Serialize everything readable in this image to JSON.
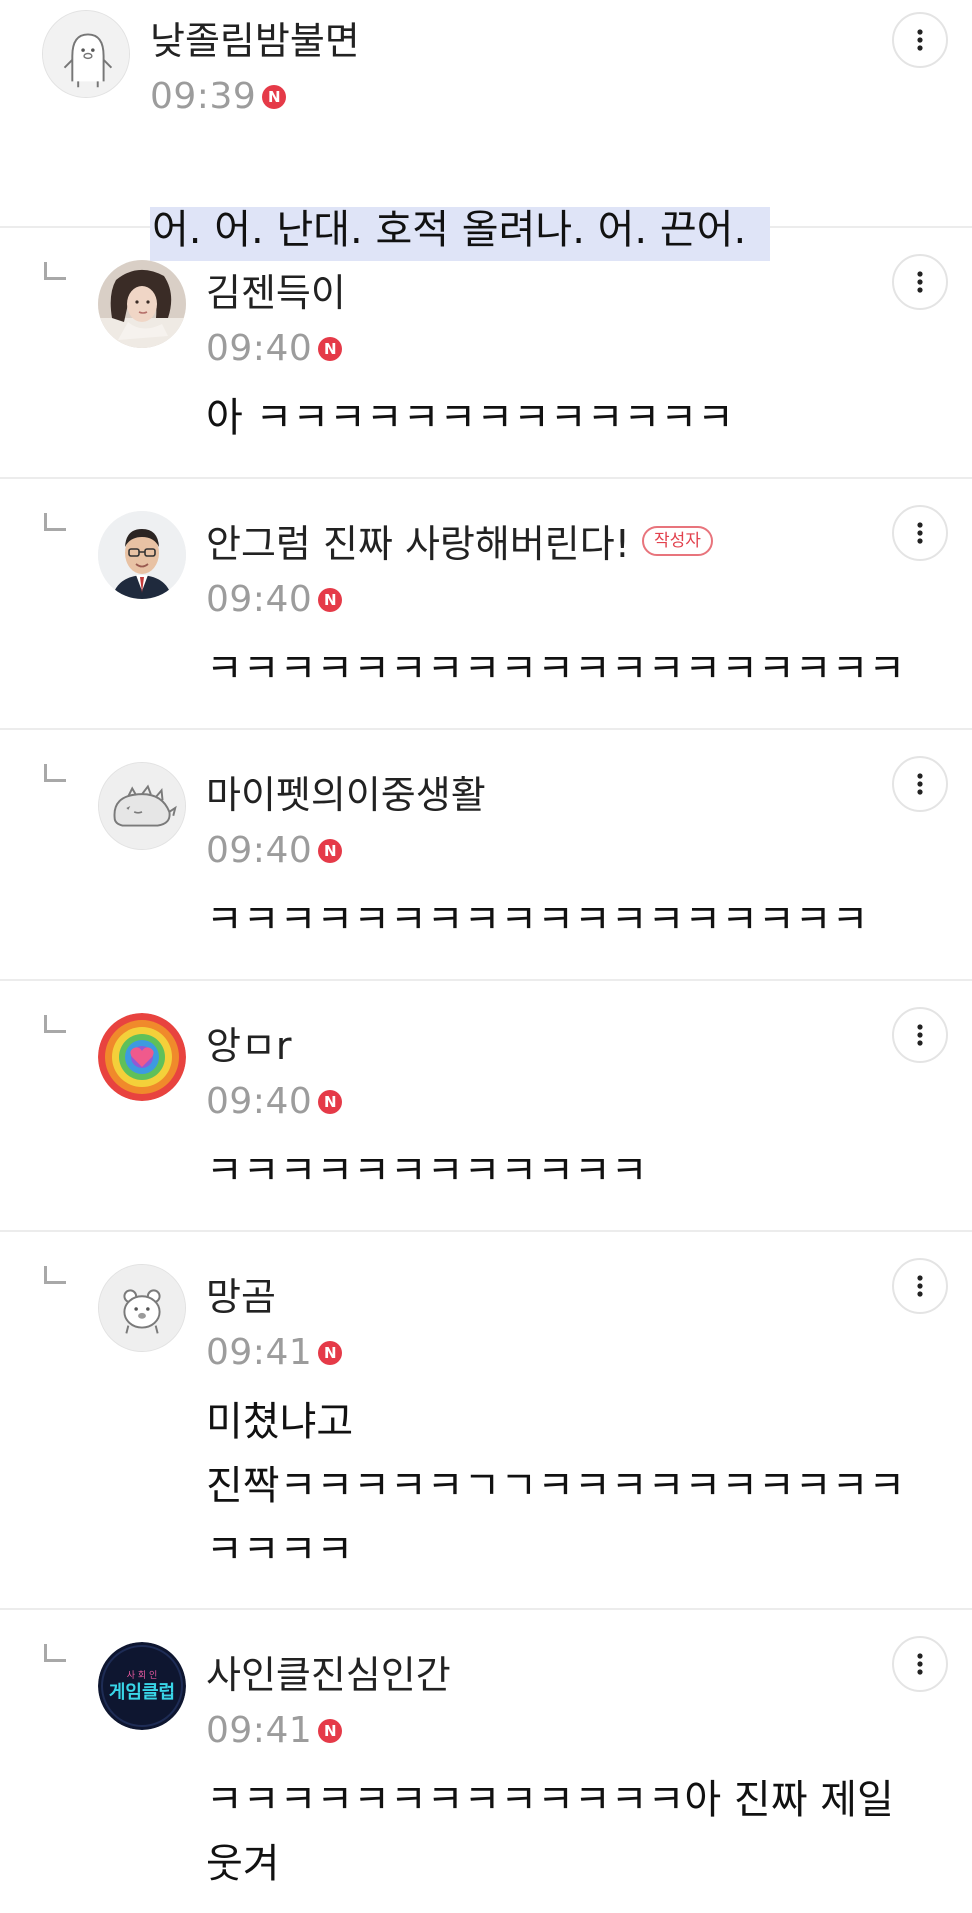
{
  "comments": [
    {
      "author": "낮졸림밤불면",
      "time": "09:39",
      "new_badge": "N",
      "body": "어. 어. 난대. 호적 올려나. 어. 끈어.",
      "is_reply": false,
      "highlighted": true,
      "avatar_icon": "penguin-doodle-icon"
    },
    {
      "author": "김젠득이",
      "time": "09:40",
      "new_badge": "N",
      "body": "아 ㅋㅋㅋㅋㅋㅋㅋㅋㅋㅋㅋㅋㅋ",
      "is_reply": true,
      "avatar_icon": "woman-photo-avatar"
    },
    {
      "author": "안그럼 진짜 사랑해버린다!",
      "author_badge": "작성자",
      "time": "09:40",
      "new_badge": "N",
      "body": "ㅋㅋㅋㅋㅋㅋㅋㅋㅋㅋㅋㅋㅋㅋㅋㅋㅋㅋㅋ",
      "is_reply": true,
      "avatar_icon": "man-glasses-photo-avatar"
    },
    {
      "author": "마이펫의이중생활",
      "time": "09:40",
      "new_badge": "N",
      "body": "ㅋㅋㅋㅋㅋㅋㅋㅋㅋㅋㅋㅋㅋㅋㅋㅋㅋㅋ",
      "is_reply": true,
      "avatar_icon": "hedgehog-doodle-icon"
    },
    {
      "author": "앙ㅁr",
      "time": "09:40",
      "new_badge": "N",
      "body": "ㅋㅋㅋㅋㅋㅋㅋㅋㅋㅋㅋㅋ",
      "is_reply": true,
      "avatar_icon": "rainbow-heart-icon"
    },
    {
      "author": "망곰",
      "time": "09:41",
      "new_badge": "N",
      "body": "미쳤냐고\n진짝ㅋㅋㅋㅋㅋㄱㄱㅋㅋㅋㅋㅋㅋㅋㅋㅋㅋ\nㅋㅋㅋㅋ",
      "is_reply": true,
      "avatar_icon": "bear-doodle-icon"
    },
    {
      "author": "사인클진심인간",
      "time": "09:41",
      "new_badge": "N",
      "body": "ㅋㅋㅋㅋㅋㅋㅋㅋㅋㅋㅋㅋㅋ아 진짜 제일\n웃겨",
      "is_reply": true,
      "avatar_icon": "game-club-logo-icon"
    }
  ],
  "colors": {
    "new_badge": "#e53a48",
    "writer_badge": "#e2414d",
    "highlight": "#dfe4f7",
    "divider": "#ececec",
    "timestamp": "#9c9c9c"
  }
}
